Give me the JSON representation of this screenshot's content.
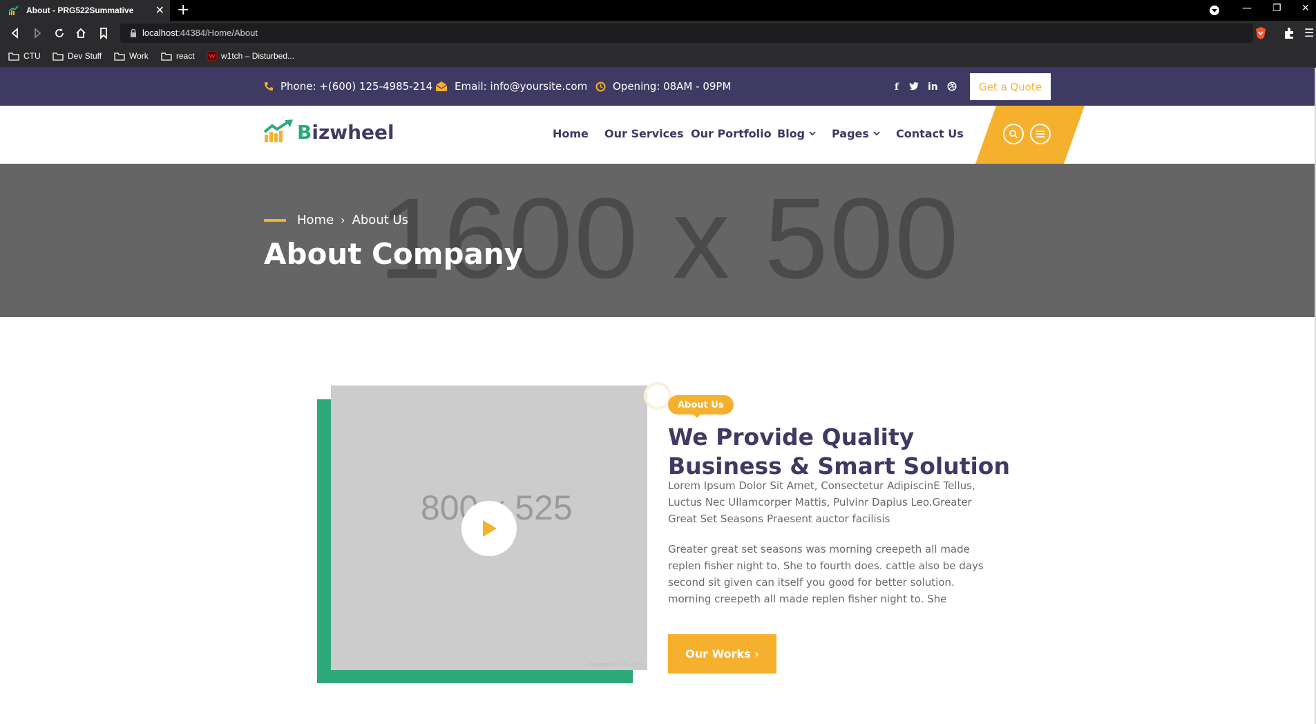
{
  "browser": {
    "tab_title": "About - PRG522Summative",
    "url_host": "localhost",
    "url_rest": ":44384/Home/About",
    "bookmarks": [
      "CTU",
      "Dev Stuff",
      "Work",
      "react",
      "w1tch – Disturbed..."
    ]
  },
  "topbar": {
    "phone": "Phone: +(600) 125-4985-214",
    "email": "Email: info@yoursite.com",
    "opening": "Opening: 08AM - 09PM",
    "social": [
      "f",
      "t",
      "in",
      "dribbble"
    ],
    "quote_label": "Get a Quote"
  },
  "nav": {
    "logo_text": "Bizwheel",
    "items": [
      "Home",
      "Our Services",
      "Our Portfolio",
      "Blog",
      "Pages",
      "Contact Us"
    ]
  },
  "hero": {
    "placeholder": "1600 x 500",
    "breadcrumb_home": "Home",
    "breadcrumb_current": "About Us",
    "title": "About Company"
  },
  "about": {
    "video_placeholder": "800 x 525",
    "watermark": "Powered by HTML.COM",
    "badge": "About Us",
    "title": "We Provide Quality Business & Smart Solution",
    "p1": "Lorem Ipsum Dolor Sit Amet, Consectetur AdipiscinE Tellus, Luctus Nec Ullamcorper Mattis, Pulvinr Dapius Leo.Greater Great Set Seasons Praesent auctor facilisis",
    "p2": "Greater great set seasons was morning creepeth all made replen fisher night to. She to fourth does. cattle also be days second sit given can itself you good for better solution. morning creepeth all made replen fisher night to. She",
    "button": "Our Works ›"
  },
  "colors": {
    "topbar": "#3e3a63",
    "accent": "#f5b12e",
    "green": "#2ea97a"
  }
}
